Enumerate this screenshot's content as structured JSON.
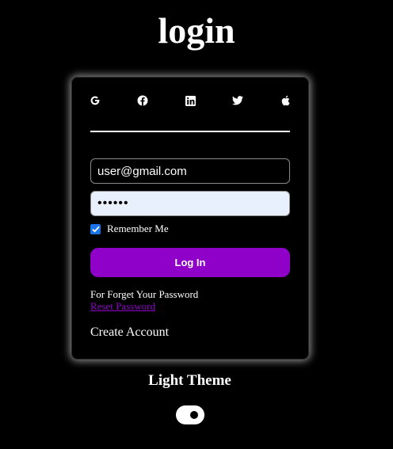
{
  "page": {
    "title": "login"
  },
  "social": {
    "icons": [
      "google-icon",
      "facebook-icon",
      "linkedin-icon",
      "twitter-icon",
      "apple-icon"
    ]
  },
  "form": {
    "email_value": "user@gmail.com",
    "password_value": "••••••",
    "remember_label": "Remember Me",
    "remember_checked": true,
    "login_label": "Log In",
    "forgot_text": "For Forget Your Password",
    "reset_link": "Reset Password",
    "create_account": "Create Account"
  },
  "theme": {
    "label": "Light Theme",
    "toggle_on": true
  },
  "colors": {
    "accent": "#8f00c8",
    "background": "#000000",
    "checkbox": "#1a73e8",
    "password_fill": "#e8f0fe"
  }
}
